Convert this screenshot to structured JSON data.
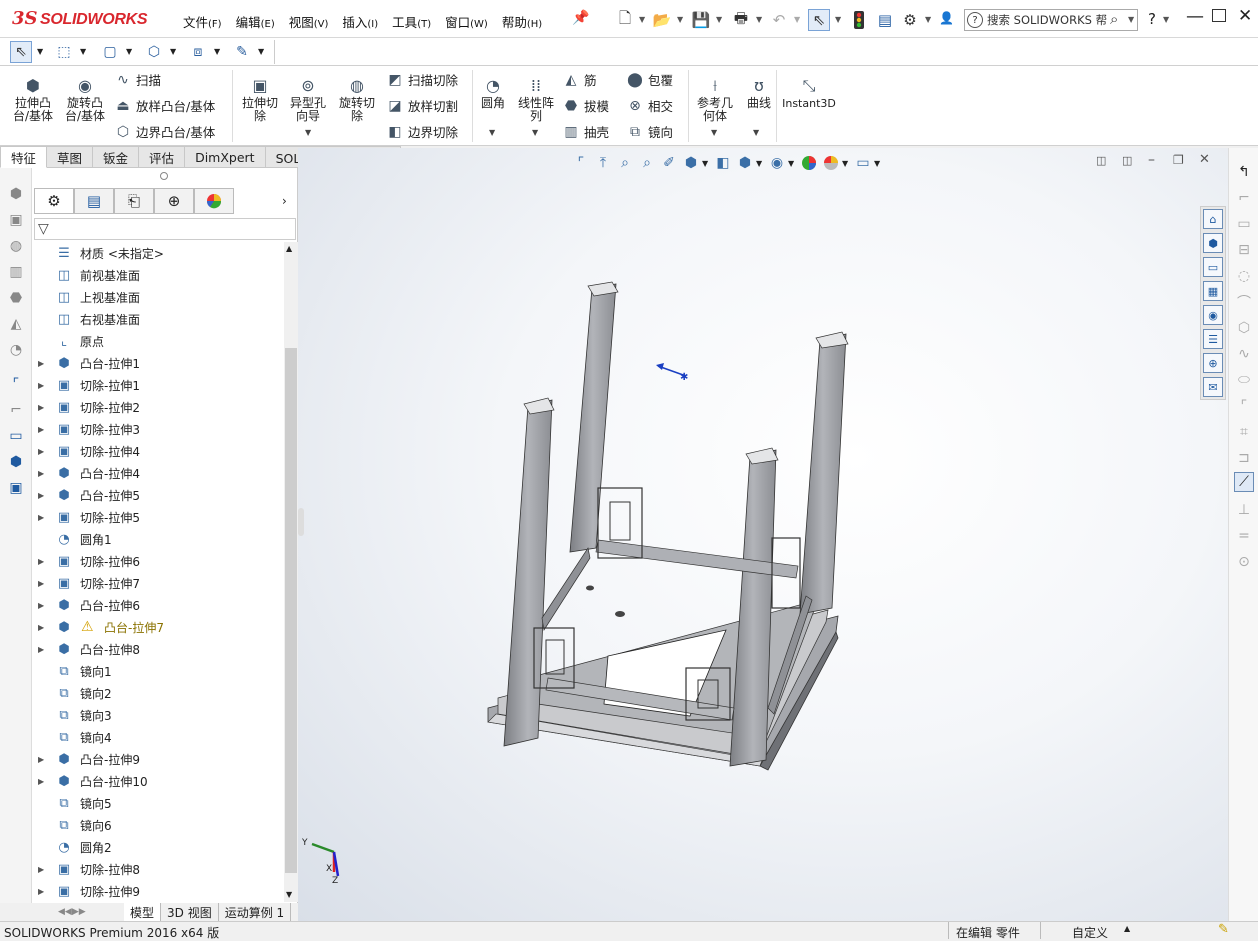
{
  "app": {
    "logo_ds": "3S",
    "logo_text": "SOLIDWORKS"
  },
  "menus": [
    {
      "label": "文件",
      "key": "(F)"
    },
    {
      "label": "编辑",
      "key": "(E)"
    },
    {
      "label": "视图",
      "key": "(V)"
    },
    {
      "label": "插入",
      "key": "(I)"
    },
    {
      "label": "工具",
      "key": "(T)"
    },
    {
      "label": "窗口",
      "key": "(W)"
    },
    {
      "label": "帮助",
      "key": "(H)"
    }
  ],
  "search": {
    "placeholder": "搜索 SOLIDWORKS 帮",
    "qi": "?"
  },
  "help_label": "?",
  "commands": {
    "extrude_boss": "拉伸凸\n台/基体",
    "revolve_boss": "旋转凸\n台/基体",
    "sweep": "扫描",
    "loft": "放样凸台/基体",
    "boundary_boss": "边界凸台/基体",
    "extrude_cut": "拉伸切\n除",
    "hole_wizard": "异型孔\n向导",
    "revolve_cut": "旋转切\n除",
    "sweep_cut": "扫描切除",
    "loft_cut": "放样切割",
    "boundary_cut": "边界切除",
    "fillet": "圆角",
    "pattern": "线性阵\n列",
    "rib": "筋",
    "draft": "拔模",
    "shell": "抽壳",
    "wrap": "包覆",
    "intersect": "相交",
    "mirror": "镜向",
    "ref_geom": "参考几\n何体",
    "curves": "曲线",
    "instant3d": "Instant3D"
  },
  "cmd_tabs": [
    "特征",
    "草图",
    "钣金",
    "评估",
    "DimXpert",
    "SOLIDWORKS 插件"
  ],
  "tree": [
    {
      "label": "材质 <未指定>",
      "icon": "material-icon",
      "glyph": "☰",
      "exp": false
    },
    {
      "label": "前视基准面",
      "icon": "plane-icon",
      "glyph": "◫",
      "exp": false
    },
    {
      "label": "上视基准面",
      "icon": "plane-icon",
      "glyph": "◫",
      "exp": false
    },
    {
      "label": "右视基准面",
      "icon": "plane-icon",
      "glyph": "◫",
      "exp": false
    },
    {
      "label": "原点",
      "icon": "origin-icon",
      "glyph": "⌞",
      "exp": false
    },
    {
      "label": "凸台-拉伸1",
      "icon": "boss-extrude-icon",
      "glyph": "⬢",
      "exp": true
    },
    {
      "label": "切除-拉伸1",
      "icon": "cut-extrude-icon",
      "glyph": "▣",
      "exp": true
    },
    {
      "label": "切除-拉伸2",
      "icon": "cut-extrude-icon",
      "glyph": "▣",
      "exp": true
    },
    {
      "label": "切除-拉伸3",
      "icon": "cut-extrude-icon",
      "glyph": "▣",
      "exp": true
    },
    {
      "label": "切除-拉伸4",
      "icon": "cut-extrude-icon",
      "glyph": "▣",
      "exp": true
    },
    {
      "label": "凸台-拉伸4",
      "icon": "boss-extrude-icon",
      "glyph": "⬢",
      "exp": true
    },
    {
      "label": "凸台-拉伸5",
      "icon": "boss-extrude-icon",
      "glyph": "⬢",
      "exp": true
    },
    {
      "label": "切除-拉伸5",
      "icon": "cut-extrude-icon",
      "glyph": "▣",
      "exp": true
    },
    {
      "label": "圆角1",
      "icon": "fillet-icon",
      "glyph": "◔",
      "exp": false
    },
    {
      "label": "切除-拉伸6",
      "icon": "cut-extrude-icon",
      "glyph": "▣",
      "exp": true
    },
    {
      "label": "切除-拉伸7",
      "icon": "cut-extrude-icon",
      "glyph": "▣",
      "exp": true
    },
    {
      "label": "凸台-拉伸6",
      "icon": "boss-extrude-icon",
      "glyph": "⬢",
      "exp": true
    },
    {
      "label": "凸台-拉伸7",
      "icon": "boss-extrude-icon",
      "glyph": "⬢",
      "exp": true,
      "warn": true
    },
    {
      "label": "凸台-拉伸8",
      "icon": "boss-extrude-icon",
      "glyph": "⬢",
      "exp": true
    },
    {
      "label": "镜向1",
      "icon": "mirror-icon",
      "glyph": "⧉",
      "exp": false
    },
    {
      "label": "镜向2",
      "icon": "mirror-icon",
      "glyph": "⧉",
      "exp": false
    },
    {
      "label": "镜向3",
      "icon": "mirror-icon",
      "glyph": "⧉",
      "exp": false
    },
    {
      "label": "镜向4",
      "icon": "mirror-icon",
      "glyph": "⧉",
      "exp": false
    },
    {
      "label": "凸台-拉伸9",
      "icon": "boss-extrude-icon",
      "glyph": "⬢",
      "exp": true
    },
    {
      "label": "凸台-拉伸10",
      "icon": "boss-extrude-icon",
      "glyph": "⬢",
      "exp": true
    },
    {
      "label": "镜向5",
      "icon": "mirror-icon",
      "glyph": "⧉",
      "exp": false
    },
    {
      "label": "镜向6",
      "icon": "mirror-icon",
      "glyph": "⧉",
      "exp": false
    },
    {
      "label": "圆角2",
      "icon": "fillet-icon",
      "glyph": "◔",
      "exp": false
    },
    {
      "label": "切除-拉伸8",
      "icon": "cut-extrude-icon",
      "glyph": "▣",
      "exp": true
    },
    {
      "label": "切除-拉伸9",
      "icon": "cut-extrude-icon",
      "glyph": "▣",
      "exp": true
    }
  ],
  "bottom_tabs": [
    "模型",
    "3D 视图",
    "运动算例 1"
  ],
  "status": {
    "left": "SOLIDWORKS Premium 2016 x64 版",
    "editing": "在编辑 零件",
    "custom": "自定义"
  },
  "triad": {
    "x": "X",
    "y": "Y",
    "z": "Z"
  },
  "colors": {
    "brand": "#d9272e",
    "model_face": "#9fa1a6",
    "accent": "#1f5aa0"
  }
}
